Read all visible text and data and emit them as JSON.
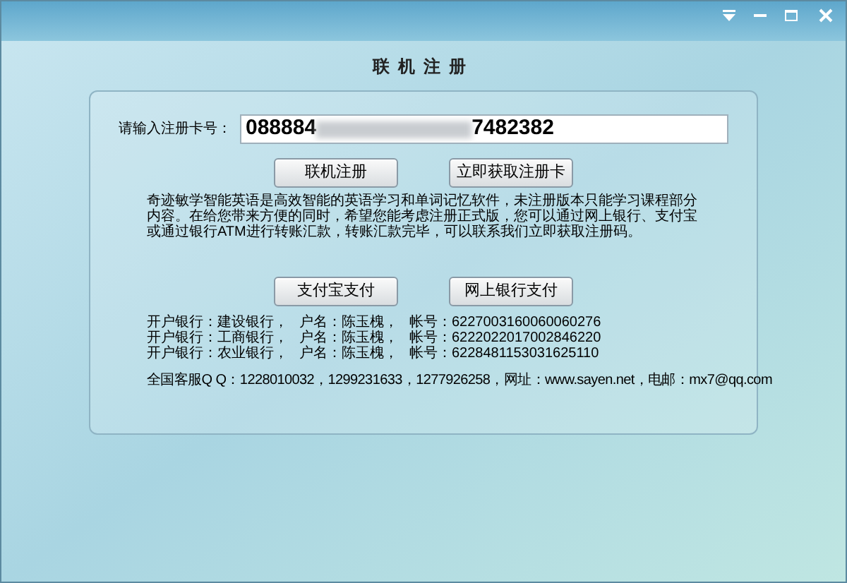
{
  "window": {
    "title": "联机注册"
  },
  "registration": {
    "label": "请输入注册卡号：",
    "value_start": "088884",
    "value_end": "7482382"
  },
  "action_buttons": [
    "联机注册",
    "立即获取注册卡"
  ],
  "description": "奇迹敏学智能英语是高效智能的英语学习和单词记忆软件，未注册版本只能学习课程部分内容。在给您带来方便的同时，希望您能考虑注册正式版，您可以通过网上银行、支付宝或通过银行ATM进行转账汇款，转账汇款完毕，可以联系我们立即获取注册码。",
  "payment_buttons": [
    "支付宝支付",
    "网上银行支付"
  ],
  "bank_accounts": [
    {
      "bank": "开户银行：建设银行，",
      "holder": "户名：陈玉槐，",
      "account": "帐号：6227003160060060276"
    },
    {
      "bank": "开户银行：工商银行，",
      "holder": "户名：陈玉槐，",
      "account": "帐号：6222022017002846220"
    },
    {
      "bank": "开户银行：农业银行，",
      "holder": "户名：陈玉槐，",
      "account": "帐号：6228481153031625110"
    }
  ],
  "contact": "全国客服Q Q：1228010032，1299231633，1277926258，网址：www.sayen.net，电邮：mx7@qq.com"
}
